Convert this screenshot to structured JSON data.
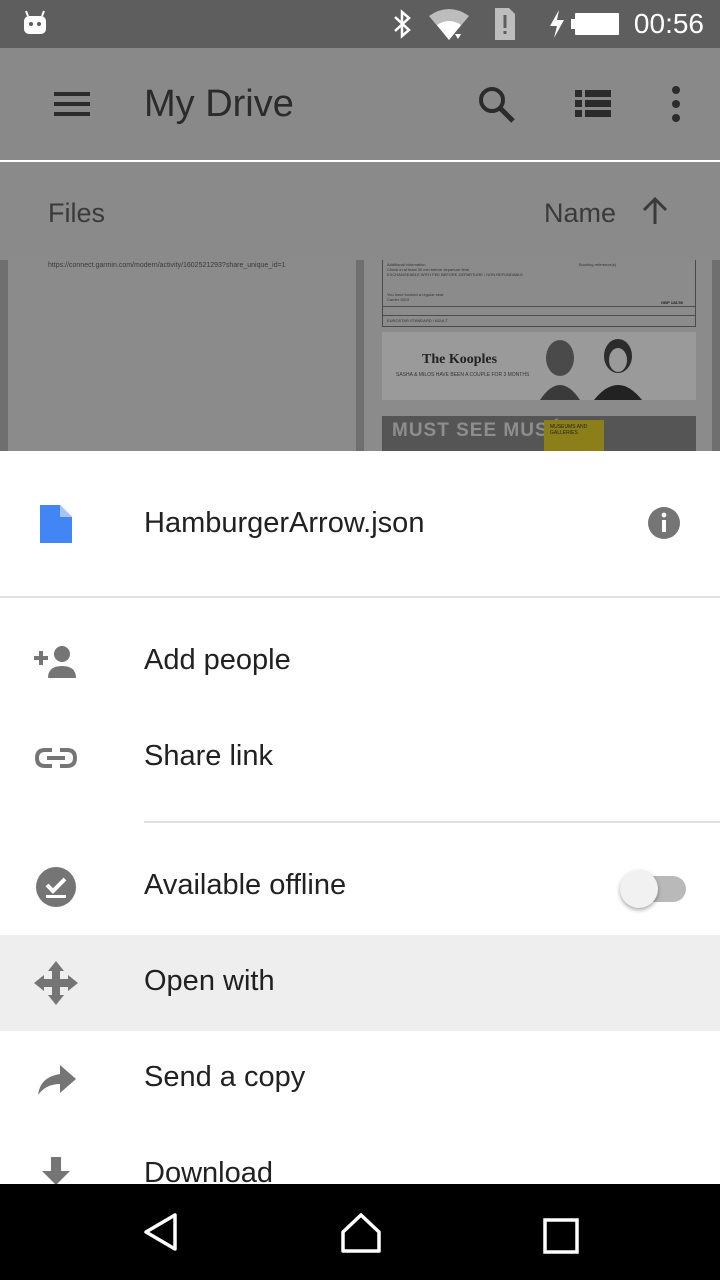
{
  "status_bar": {
    "time": "00:56",
    "icons": [
      "android-icon",
      "bluetooth-icon",
      "wifi-icon",
      "alert-sim-icon",
      "charging-bolt-icon",
      "battery-icon"
    ]
  },
  "app_bar": {
    "title": "My Drive",
    "icons": [
      "menu-icon",
      "search-icon",
      "list-view-icon",
      "more-vert-icon"
    ]
  },
  "sub_header": {
    "section": "Files",
    "sort_label": "Name",
    "sort_icon": "arrow-up-icon"
  },
  "background_files": {
    "left_card_url": "https://connect.garmin.com/modern/activity/1602521293?share_unique_id=1",
    "right_card": {
      "doc_lines": [
        "Additional information",
        "Booking reference(s)",
        "Check in at least 30 min before departure time",
        "EXCHANGEABLE WITH FEE BEFORE DEPARTURE / NON REFUNDABLE",
        "You have booked a regular seat",
        "Carrier 9319",
        "GBP 128.50",
        "EUROSTAR STANDARD / ADULT"
      ],
      "ad_brand": "The Kooples",
      "ad_tagline": "SASHA & MILOS HAVE BEEN A COUPLE FOR 3 MONTHS",
      "ad2_text": "MUST SEE MUSÉES",
      "ad2_box": "MUSEUMS AND GALLERIES"
    }
  },
  "sheet": {
    "file_name": "HamburgerArrow.json",
    "file_icon": "document-icon",
    "info_icon": "info-icon",
    "actions": [
      {
        "label": "Add people",
        "icon": "add-person-icon"
      },
      {
        "label": "Share link",
        "icon": "link-icon"
      },
      {
        "label": "Available offline",
        "icon": "offline-check-icon",
        "toggle": false
      },
      {
        "label": "Open with",
        "icon": "open-with-icon",
        "highlighted": true
      },
      {
        "label": "Send a copy",
        "icon": "share-forward-icon"
      },
      {
        "label": "Download",
        "icon": "download-icon"
      }
    ]
  },
  "nav_bar": {
    "icons": [
      "back-icon",
      "home-icon",
      "recents-icon"
    ]
  }
}
